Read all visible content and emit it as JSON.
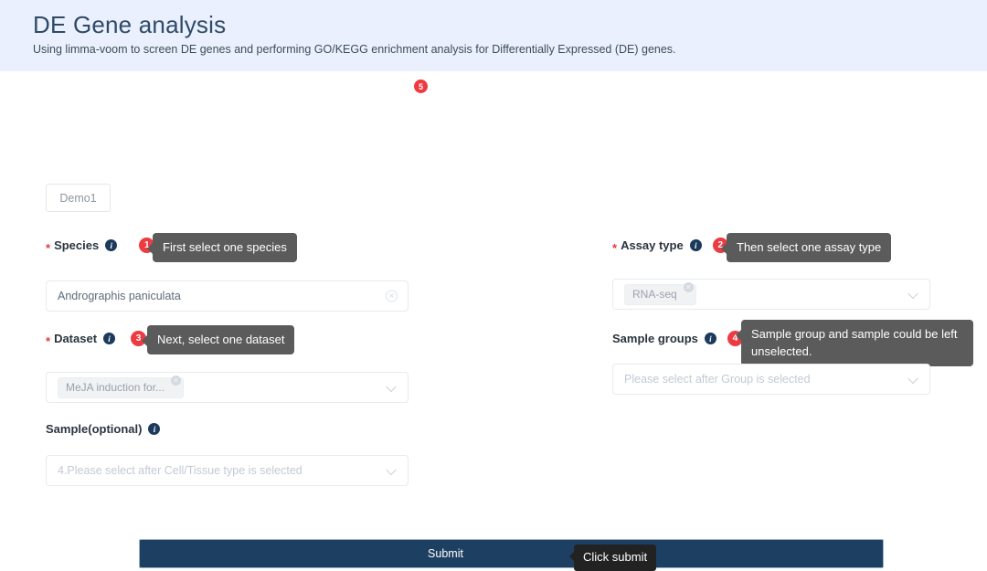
{
  "header": {
    "title": "DE Gene analysis",
    "subtitle": "Using limma-voom to screen DE genes and performing GO/KEGG enrichment analysis for Differentially Expressed (DE) genes.",
    "background_color": "#eaf0fd",
    "title_color": "#2f4a66"
  },
  "tabs": {
    "demo_label": "Demo1"
  },
  "accent": {
    "badge_color": "#ec3b41",
    "required_star_color": "#e8363d",
    "tooltip_color": "#5b5b5b",
    "submit_color": "#1d4062"
  },
  "fields": {
    "species": {
      "label": "Species",
      "required_mark": "*",
      "info_icon": "info-icon",
      "step": "1",
      "tooltip": "First select one species",
      "value": "Andrographis paniculata",
      "clear_icon": "clear-circle-icon"
    },
    "assay_type": {
      "label": "Assay type",
      "required_mark": "*",
      "info_icon": "info-icon",
      "step": "2",
      "tooltip": "Then select one assay type",
      "tag": "RNA-seq",
      "tag_remove_icon": "remove-tag-icon",
      "chevron_icon": "chevron-down-icon"
    },
    "dataset": {
      "label": "Dataset",
      "required_mark": "*",
      "info_icon": "info-icon",
      "step": "3",
      "tooltip": "Next, select one dataset",
      "tag": "MeJA induction for...",
      "tag_remove_icon": "remove-tag-icon",
      "chevron_icon": "chevron-down-icon"
    },
    "sample_groups": {
      "label": "Sample groups",
      "info_icon": "info-icon",
      "step": "4",
      "tooltip": "Sample group and sample could be left unselected.",
      "placeholder": "Please select after Group is selected",
      "chevron_icon": "chevron-down-icon"
    },
    "sample": {
      "label": "Sample(optional)",
      "info_icon": "info-icon",
      "placeholder": "4.Please select after Cell/Tissue type is selected",
      "chevron_icon": "chevron-down-icon"
    }
  },
  "submit": {
    "label": "Submit",
    "step": "5",
    "tooltip": "Click submit"
  }
}
